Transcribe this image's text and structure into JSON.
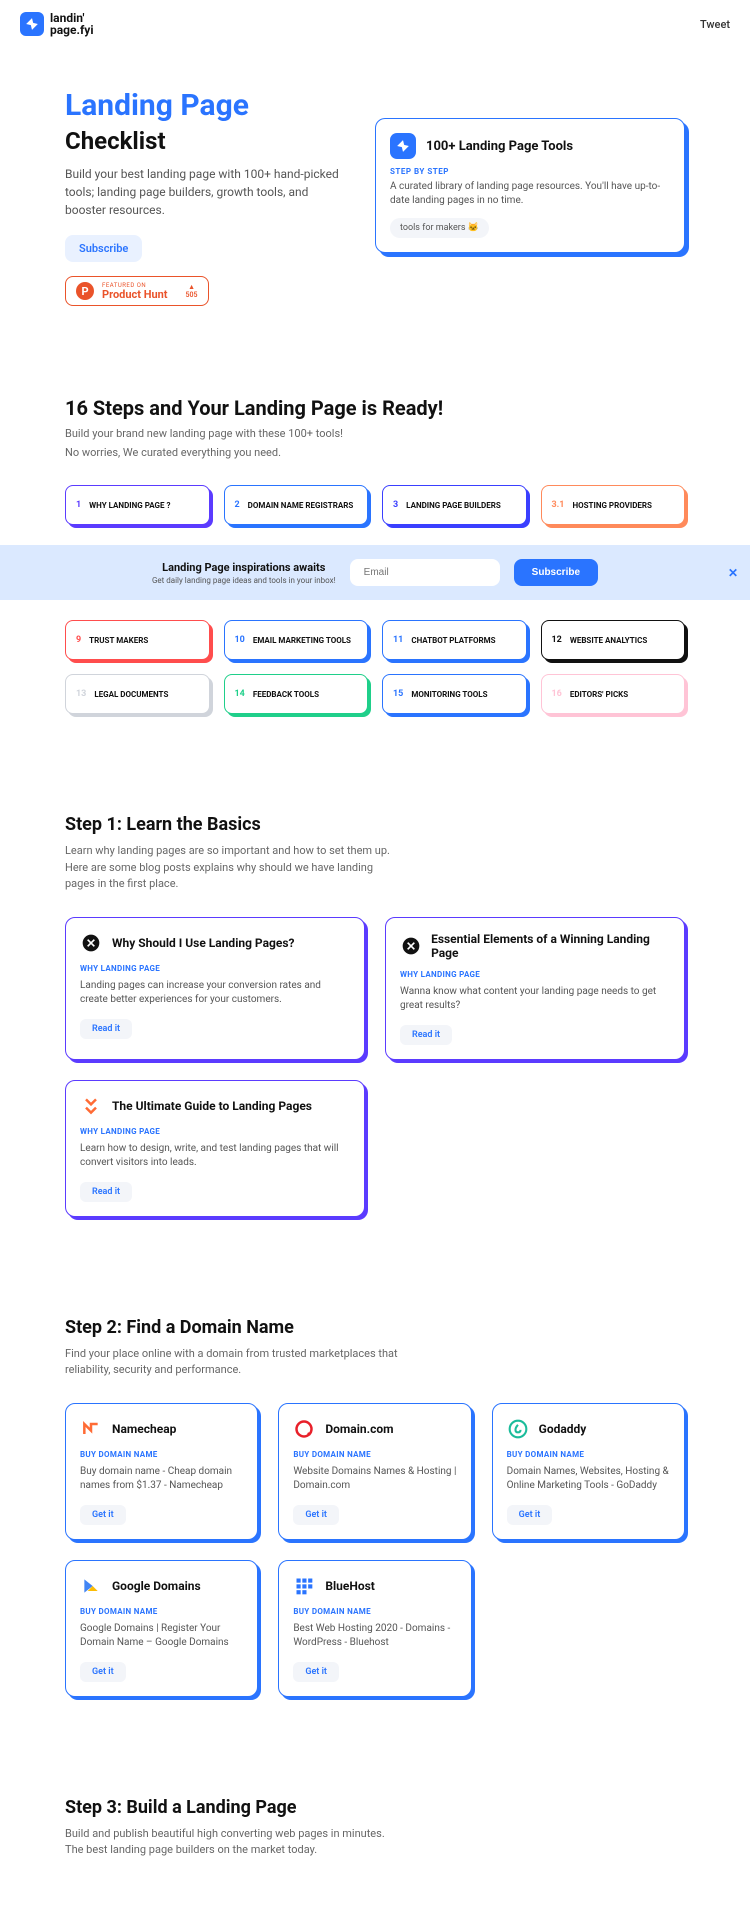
{
  "header": {
    "logo_text_1": "landin'",
    "logo_text_2": "page.fyi",
    "tweet": "Tweet"
  },
  "hero": {
    "title_1": "Landing Page",
    "title_2": "Checklist",
    "desc": "Build your best landing page with 100+ hand-picked tools; landing page builders, growth tools, and booster resources.",
    "subscribe": "Subscribe",
    "ph_top": "FEATURED ON",
    "ph_name": "Product Hunt",
    "ph_count": "505",
    "card": {
      "title": "100+ Landing Page Tools",
      "tag": "STEP BY STEP",
      "desc": "A curated library of landing page resources. You'll have up-to-date landing pages in no time.",
      "pill": "tools for makers 🐱"
    }
  },
  "steps_section": {
    "title": "16 Steps and Your Landing Page is Ready!",
    "sub1": "Build your brand new landing page with these 100+ tools!",
    "sub2": "No worries, We curated everything you need."
  },
  "chips": [
    {
      "num": "1",
      "label": "WHY LANDING PAGE ?",
      "color": "c-purple"
    },
    {
      "num": "2",
      "label": "DOMAIN NAME REGISTRARS",
      "color": "c-blue"
    },
    {
      "num": "3",
      "label": "LANDING PAGE BUILDERS",
      "color": "c-darkblue"
    },
    {
      "num": "3.1",
      "label": "HOSTING PROVIDERS",
      "color": "c-orange"
    },
    {
      "num": "9",
      "label": "TRUST MAKERS",
      "color": "c-red"
    },
    {
      "num": "10",
      "label": "EMAIL MARKETING TOOLS",
      "color": "c-blue"
    },
    {
      "num": "11",
      "label": "CHATBOT PLATFORMS",
      "color": "c-blue"
    },
    {
      "num": "12",
      "label": "WEBSITE ANALYTICS",
      "color": "c-black"
    },
    {
      "num": "13",
      "label": "LEGAL DOCUMENTS",
      "color": "c-gray"
    },
    {
      "num": "14",
      "label": "FEEDBACK TOOLS",
      "color": "c-green"
    },
    {
      "num": "15",
      "label": "MONITORING TOOLS",
      "color": "c-blue"
    },
    {
      "num": "16",
      "label": "EDITORS' PICKS",
      "color": "c-pink"
    }
  ],
  "banner": {
    "t1": "Landing Page inspirations awaits",
    "t2": "Get daily landing page ideas and tools in your inbox!",
    "placeholder": "Email",
    "btn": "Subscribe"
  },
  "step1": {
    "heading": "Step 1: Learn the Basics",
    "desc": "Learn why landing pages are so important and how to set them up. Here are some blog posts explains why should we have landing pages in the first place.",
    "cards": [
      {
        "title": "Why Should I Use Landing Pages?",
        "tag": "WHY LANDING PAGE",
        "desc": "Landing pages can increase your conversion rates and create better experiences for your customers.",
        "btn": "Read it"
      },
      {
        "title": "Essential Elements of a Winning Landing Page",
        "tag": "WHY LANDING PAGE",
        "desc": "Wanna know what content your landing page needs to get great results?",
        "btn": "Read it"
      },
      {
        "title": "The Ultimate Guide to Landing Pages",
        "tag": "WHY LANDING PAGE",
        "desc": "Learn how to design, write, and test landing pages that will convert visitors into leads.",
        "btn": "Read it"
      }
    ]
  },
  "step2": {
    "heading": "Step 2: Find a Domain Name",
    "desc": "Find your place online with a domain from trusted marketplaces that reliability, security and performance.",
    "cards": [
      {
        "title": "Namecheap",
        "tag": "BUY DOMAIN NAME",
        "desc": "Buy domain name - Cheap domain names from $1.37 - Namecheap",
        "btn": "Get it"
      },
      {
        "title": "Domain.com",
        "tag": "BUY DOMAIN NAME",
        "desc": "Website Domains Names & Hosting | Domain.com",
        "btn": "Get it"
      },
      {
        "title": "Godaddy",
        "tag": "BUY DOMAIN NAME",
        "desc": "Domain Names, Websites, Hosting & Online Marketing Tools - GoDaddy",
        "btn": "Get it"
      },
      {
        "title": "Google Domains",
        "tag": "BUY DOMAIN NAME",
        "desc": "Google Domains | Register Your Domain Name – Google Domains",
        "btn": "Get it"
      },
      {
        "title": "BlueHost",
        "tag": "BUY DOMAIN NAME",
        "desc": "Best Web Hosting 2020 - Domains - WordPress - Bluehost",
        "btn": "Get it"
      }
    ]
  },
  "step3": {
    "heading": "Step 3: Build a Landing Page",
    "desc": "Build and publish beautiful high converting web pages in minutes. The best landing page builders on the market today."
  }
}
